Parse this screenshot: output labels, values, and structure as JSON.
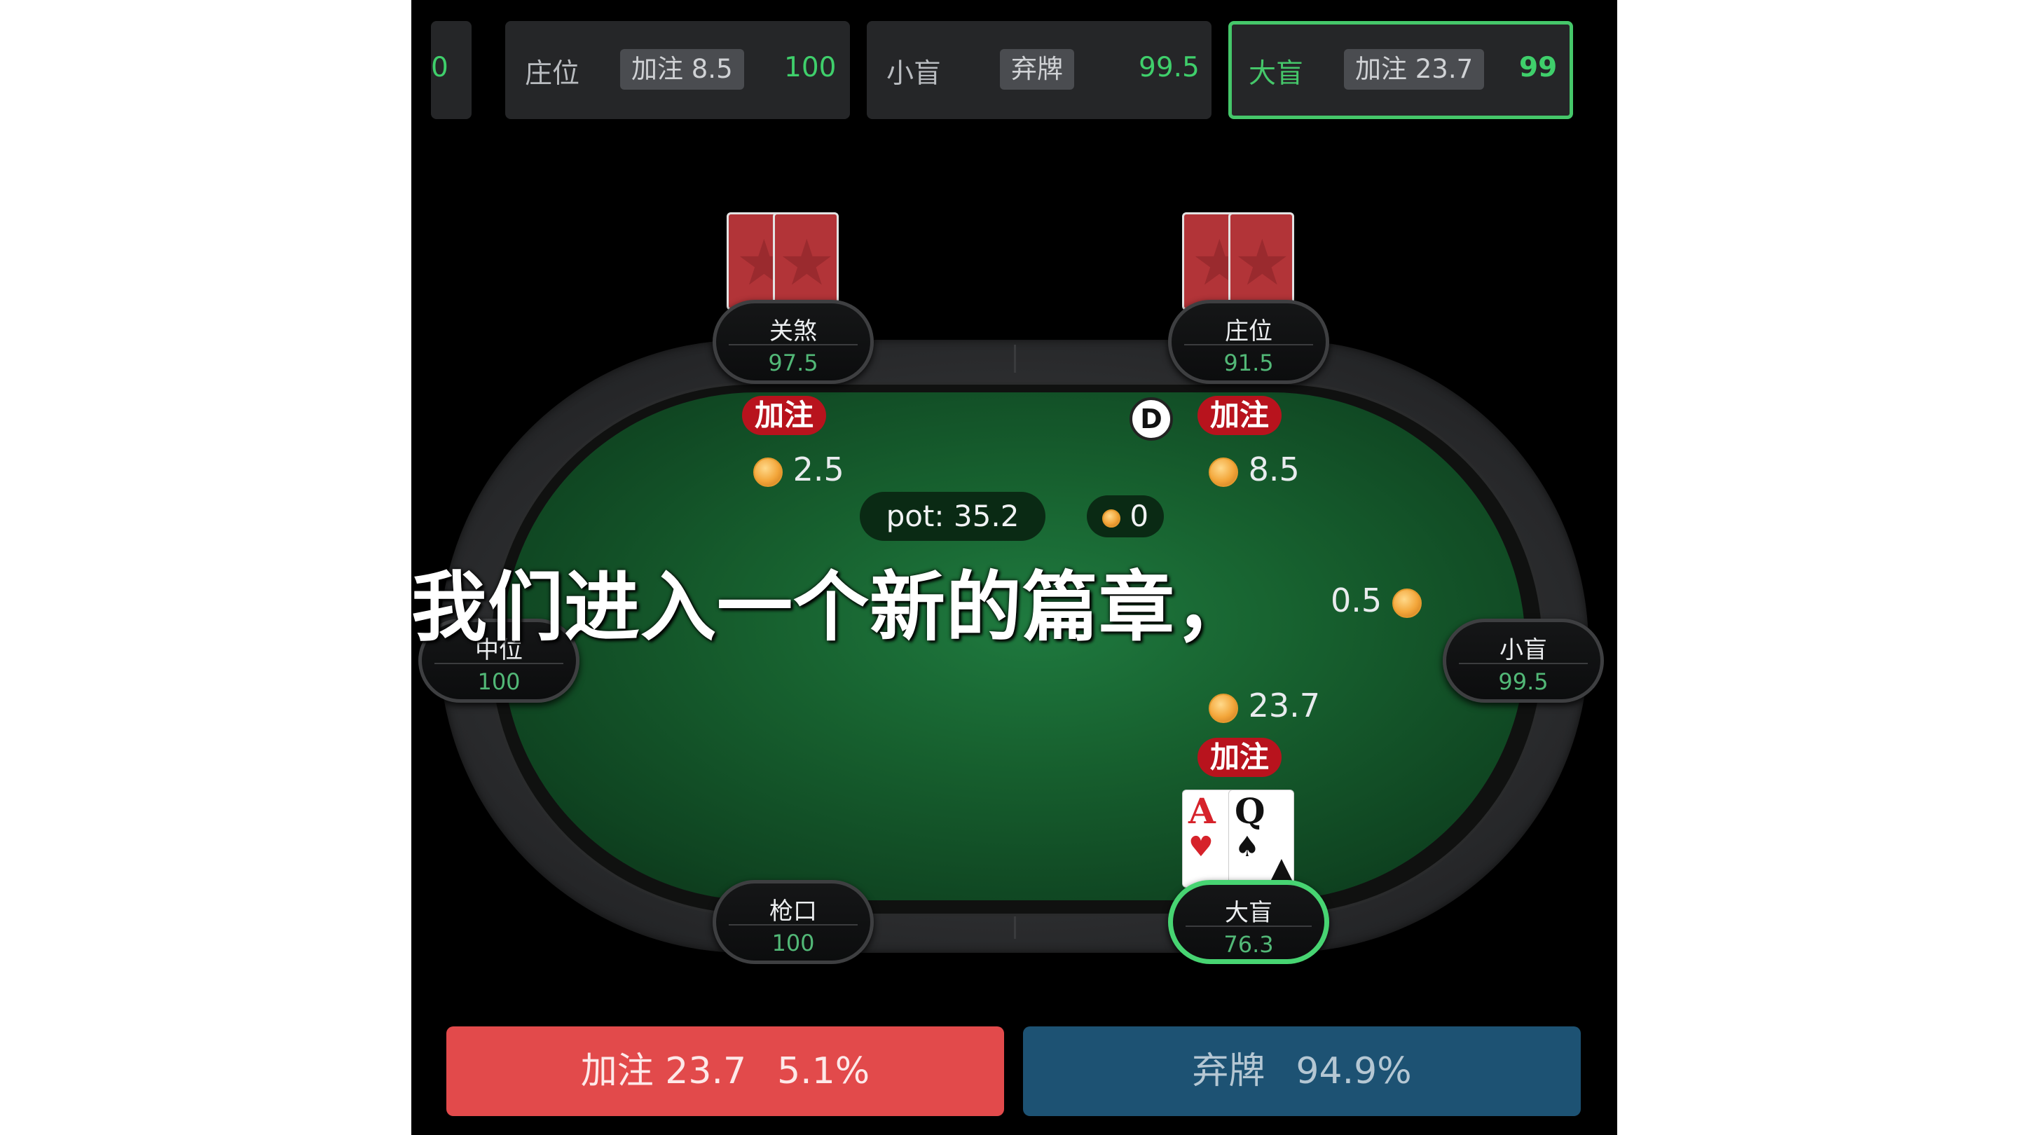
{
  "history": [
    {
      "position": "",
      "action": "",
      "stack": "0"
    },
    {
      "position": "庄位",
      "action": "加注 8.5",
      "stack": "100"
    },
    {
      "position": "小盲",
      "action": "弃牌",
      "stack": "99.5"
    },
    {
      "position": "大盲",
      "action": "加注 23.7",
      "stack": "99",
      "active": true
    }
  ],
  "seats": {
    "guansha": {
      "name": "关煞",
      "stack": "97.5"
    },
    "button": {
      "name": "庄位",
      "stack": "91.5"
    },
    "middle": {
      "name": "中位",
      "stack": "100"
    },
    "smallblind": {
      "name": "小盲",
      "stack": "99.5"
    },
    "utg": {
      "name": "枪口",
      "stack": "100"
    },
    "bigblind": {
      "name": "大盲",
      "stack": "76.3"
    }
  },
  "bets": {
    "guansha": {
      "badge": "加注",
      "amount": "2.5"
    },
    "button": {
      "badge": "加注",
      "amount": "8.5"
    },
    "smallblind": {
      "amount": "0.5"
    },
    "bigblind": {
      "badge": "加注",
      "amount": "23.7"
    }
  },
  "pot": {
    "label": "pot: 35.2",
    "side": "0"
  },
  "dealer_button": "D",
  "hero_cards": [
    {
      "rank": "A",
      "suit": "♥",
      "color": "#d6222a"
    },
    {
      "rank": "Q",
      "suit": "♠",
      "color": "#111111"
    }
  ],
  "subtitle": "我们进入一个新的篇章，",
  "actions": {
    "raise_label": "加注 23.7",
    "raise_freq": "5.1%",
    "fold_label": "弃牌",
    "fold_freq": "94.9%"
  },
  "colors": {
    "accent_green": "#45c76a",
    "raise_red": "#e24a4b",
    "fold_blue": "#1d5273",
    "felt": "#17612f"
  }
}
